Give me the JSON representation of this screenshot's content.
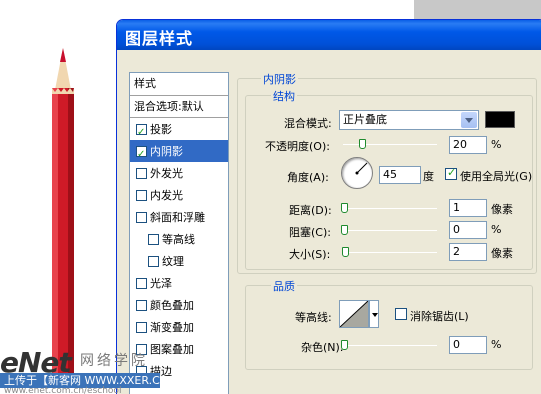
{
  "window": {
    "title": "图层样式"
  },
  "styles_list": {
    "header": "样式",
    "blend_options": "混合选项:默认",
    "items": [
      {
        "label": "投影",
        "checked": true,
        "selected": false,
        "sub": false
      },
      {
        "label": "内阴影",
        "checked": true,
        "selected": true,
        "sub": false
      },
      {
        "label": "外发光",
        "checked": false,
        "selected": false,
        "sub": false
      },
      {
        "label": "内发光",
        "checked": false,
        "selected": false,
        "sub": false
      },
      {
        "label": "斜面和浮雕",
        "checked": false,
        "selected": false,
        "sub": false
      },
      {
        "label": "等高线",
        "checked": false,
        "selected": false,
        "sub": true
      },
      {
        "label": "纹理",
        "checked": false,
        "selected": false,
        "sub": true
      },
      {
        "label": "光泽",
        "checked": false,
        "selected": false,
        "sub": false
      },
      {
        "label": "颜色叠加",
        "checked": false,
        "selected": false,
        "sub": false
      },
      {
        "label": "渐变叠加",
        "checked": false,
        "selected": false,
        "sub": false
      },
      {
        "label": "图案叠加",
        "checked": false,
        "selected": false,
        "sub": false
      },
      {
        "label": "描边",
        "checked": false,
        "selected": false,
        "sub": false
      }
    ]
  },
  "inner_shadow": {
    "title": "内阴影",
    "structure": {
      "title": "结构",
      "blend_mode_label": "混合模式:",
      "blend_mode_value": "正片叠底",
      "color": "#000000",
      "opacity_label": "不透明度(O):",
      "opacity_value": "20",
      "opacity_unit": "%",
      "opacity_level": 0.2,
      "angle_label": "角度(A):",
      "angle_value": "45",
      "angle_unit": "度",
      "global_light_label": "使用全局光(G)",
      "global_light_checked": true,
      "distance_label": "距离(D):",
      "distance_value": "1",
      "distance_unit": "像素",
      "choke_label": "阻塞(C):",
      "choke_value": "0",
      "choke_unit": "%",
      "size_label": "大小(S):",
      "size_value": "2",
      "size_unit": "像素"
    },
    "quality": {
      "title": "品质",
      "contour_label": "等高线:",
      "antialias_label": "消除锯齿(L)",
      "antialias_checked": false,
      "noise_label": "杂色(N):",
      "noise_value": "0",
      "noise_unit": "%"
    }
  },
  "watermark": {
    "logo": "eNet",
    "cn": "网络学院",
    "bar": "上传于【新客网 WWW.XXER.COM】",
    "url": "www.enet.com.cn/eschool"
  },
  "colors": {
    "title_bar": "#0055e5",
    "selection": "#316ac5",
    "pencil": "#d21d2a"
  }
}
